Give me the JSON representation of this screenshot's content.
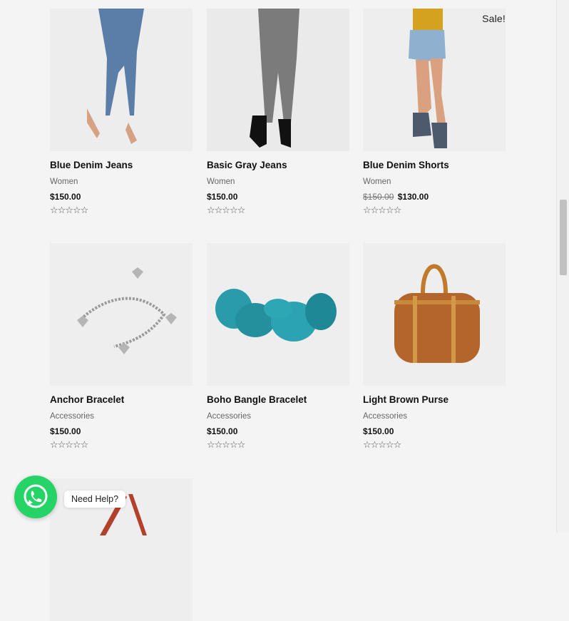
{
  "products": [
    {
      "title": "Blue Denim Jeans",
      "category": "Women",
      "price": "$150.00",
      "old_price": "",
      "rating": "☆☆☆☆☆",
      "sale": ""
    },
    {
      "title": "Basic Gray Jeans",
      "category": "Women",
      "price": "$150.00",
      "old_price": "",
      "rating": "☆☆☆☆☆",
      "sale": ""
    },
    {
      "title": "Blue Denim Shorts",
      "category": "Women",
      "price": "$130.00",
      "old_price": "$150.00",
      "rating": "☆☆☆☆☆",
      "sale": "Sale!"
    },
    {
      "title": "Anchor Bracelet",
      "category": "Accessories",
      "price": "$150.00",
      "old_price": "",
      "rating": "☆☆☆☆☆",
      "sale": ""
    },
    {
      "title": "Boho Bangle Bracelet",
      "category": "Accessories",
      "price": "$150.00",
      "old_price": "",
      "rating": "☆☆☆☆☆",
      "sale": ""
    },
    {
      "title": "Light Brown Purse",
      "category": "Accessories",
      "price": "$150.00",
      "old_price": "",
      "rating": "☆☆☆☆☆",
      "sale": ""
    }
  ],
  "whatsapp": {
    "label": "Need Help?"
  },
  "colors": {
    "whatsapp": "#25d366",
    "background": "#f4f4f4"
  }
}
